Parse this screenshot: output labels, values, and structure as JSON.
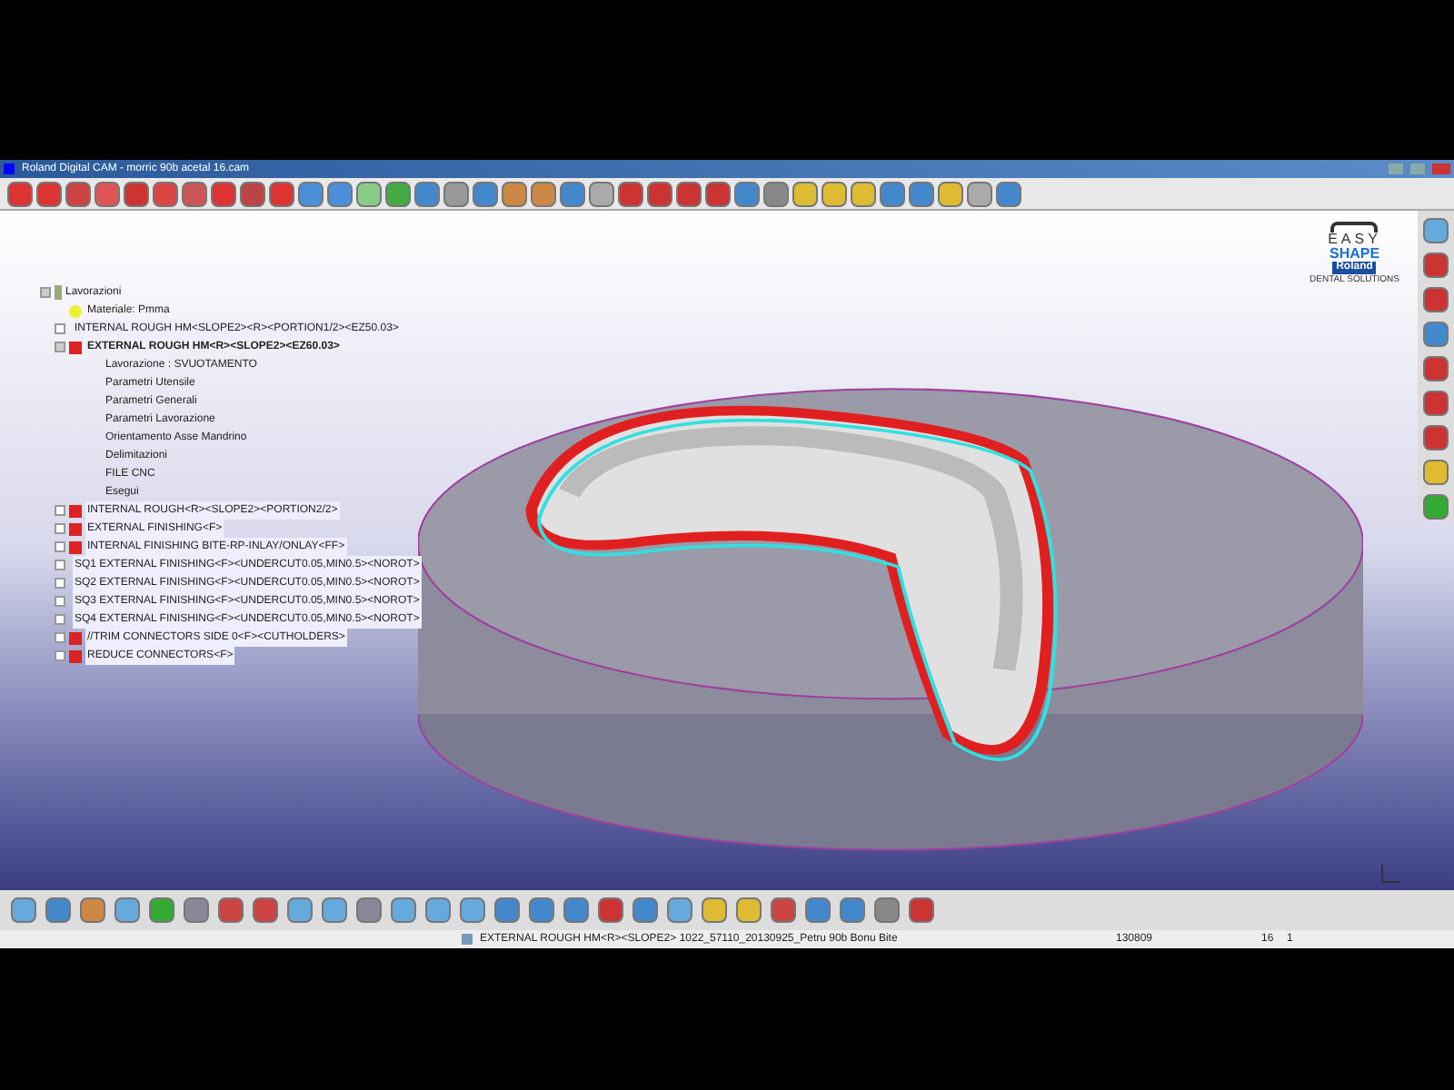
{
  "window": {
    "title": "Roland Digital CAM - morric 90b acetal 16.cam"
  },
  "logo": {
    "line1": "EASY",
    "line2": "SHAPE",
    "brand": "Roland",
    "tagline": "DENTAL SOLUTIONS"
  },
  "tree": {
    "label": "Lavorazioni",
    "expanded": true,
    "children": [
      {
        "kind": "material",
        "label": "Materiale: Pmma"
      },
      {
        "kind": "operation",
        "label": "INTERNAL ROUGH HM<SLOPE2><R><PORTION1/2><EZ50.03>",
        "expanded": false,
        "selected": false
      },
      {
        "kind": "operation",
        "label": "EXTERNAL ROUGH HM<R><SLOPE2><EZ60.03>",
        "expanded": true,
        "selected": true,
        "children": [
          "Lavorazione : SVUOTAMENTO",
          "Parametri Utensile",
          "Parametri Generali",
          "Parametri Lavorazione",
          "Orientamento Asse Mandrino",
          "Delimitazioni",
          "FILE CNC",
          "Esegui"
        ]
      },
      {
        "kind": "operation",
        "label": "INTERNAL ROUGH<R><SLOPE2><PORTION2/2>",
        "expanded": false,
        "selected": false
      },
      {
        "kind": "operation",
        "label": "EXTERNAL FINISHING<F>",
        "expanded": false,
        "selected": false
      },
      {
        "kind": "operation",
        "label": "INTERNAL FINISHING BITE-RP-INLAY/ONLAY<FF>",
        "expanded": false,
        "selected": false
      },
      {
        "kind": "operation",
        "label": "SQ1 EXTERNAL FINISHING<F><UNDERCUT0.05,MIN0.5><NOROT>",
        "expanded": false,
        "selected": false
      },
      {
        "kind": "operation",
        "label": "SQ2 EXTERNAL FINISHING<F><UNDERCUT0.05,MIN0.5><NOROT>",
        "expanded": false,
        "selected": false
      },
      {
        "kind": "operation",
        "label": "SQ3 EXTERNAL FINISHING<F><UNDERCUT0.05,MIN0.5><NOROT>",
        "expanded": false,
        "selected": false
      },
      {
        "kind": "operation",
        "label": "SQ4 EXTERNAL FINISHING<F><UNDERCUT0.05,MIN0.5><NOROT>",
        "expanded": false,
        "selected": false
      },
      {
        "kind": "operation",
        "label": "//TRIM CONNECTORS SIDE 0<F><CUTHOLDERS>",
        "expanded": false,
        "selected": false
      },
      {
        "kind": "operation",
        "label": "REDUCE CONNECTORS<F>",
        "expanded": false,
        "selected": false
      }
    ]
  },
  "status_bar": {
    "operation": "EXTERNAL ROUGH HM<R><SLOPE2> 1022_57110_20130925_Petru 90b Bonu Bite",
    "field_2": "130809",
    "field_3": "16",
    "field_4": "1"
  }
}
